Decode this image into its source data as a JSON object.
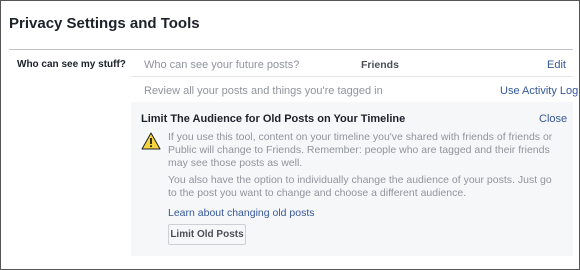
{
  "page": {
    "title": "Privacy Settings and Tools"
  },
  "section": {
    "label": "Who can see my stuff?"
  },
  "rows": [
    {
      "question": "Who can see your future posts?",
      "value": "Friends",
      "action": "Edit"
    },
    {
      "question": "Review all your posts and things you're tagged in",
      "action": "Use Activity Log"
    }
  ],
  "panel": {
    "title": "Limit The Audience for Old Posts on Your Timeline",
    "close_label": "Close",
    "icon": "warning-icon",
    "paragraph1": "If you use this tool, content on your timeline you've shared with friends of friends or Public will change to Friends. Remember: people who are tagged and their friends may see those posts as well.",
    "paragraph2": "You also have the option to individually change the audience of your posts. Just go to the post you want to change and choose a different audience.",
    "learn_link": "Learn about changing old posts",
    "button_label": "Limit Old Posts"
  },
  "colors": {
    "link": "#365899",
    "muted_text": "#90949c",
    "panel_background": "#f6f7f9",
    "warning_yellow": "#f7d43a"
  }
}
